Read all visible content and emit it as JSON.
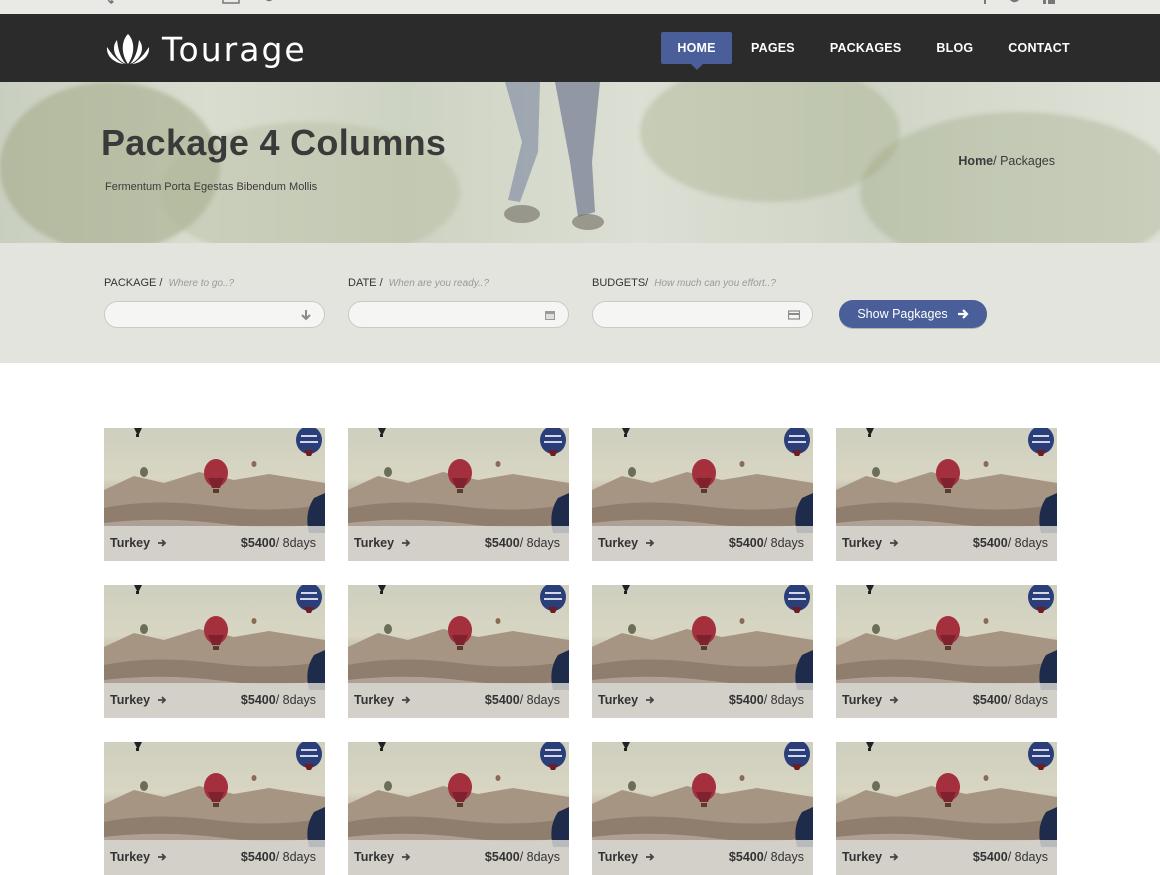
{
  "brand": {
    "name": "Tourage"
  },
  "nav": {
    "items": [
      {
        "label": "HOME",
        "active": true
      },
      {
        "label": "PAGES"
      },
      {
        "label": "PACKAGES"
      },
      {
        "label": "BLOG"
      },
      {
        "label": "CONTACT"
      }
    ]
  },
  "hero": {
    "title": "Package 4 Columns",
    "subtitle": "Fermentum Porta Egestas Bibendum Mollis",
    "breadcrumb": {
      "home": "Home",
      "separator": "/ ",
      "current": "Packages"
    }
  },
  "search": {
    "package": {
      "label": "PACKAGE /",
      "hint": "Where to go..?",
      "value": "",
      "icon": "arrow-down-icon"
    },
    "date": {
      "label": "DATE /",
      "hint": "When are you ready..?",
      "value": "",
      "icon": "calendar-icon"
    },
    "budget": {
      "label": "BUDGETS/",
      "hint": "How much can you effort..?",
      "value": "",
      "icon": "credit-card-icon"
    },
    "button": {
      "label": "Show Pagkages",
      "icon": "arrow-right-icon"
    }
  },
  "packages": [
    {
      "place": "Turkey",
      "price": "$5400",
      "duration": "/ 8days"
    },
    {
      "place": "Turkey",
      "price": "$5400",
      "duration": "/ 8days"
    },
    {
      "place": "Turkey",
      "price": "$5400",
      "duration": "/ 8days"
    },
    {
      "place": "Turkey",
      "price": "$5400",
      "duration": "/ 8days"
    },
    {
      "place": "Turkey",
      "price": "$5400",
      "duration": "/ 8days"
    },
    {
      "place": "Turkey",
      "price": "$5400",
      "duration": "/ 8days"
    },
    {
      "place": "Turkey",
      "price": "$5400",
      "duration": "/ 8days"
    },
    {
      "place": "Turkey",
      "price": "$5400",
      "duration": "/ 8days"
    },
    {
      "place": "Turkey",
      "price": "$5400",
      "duration": "/ 8days"
    },
    {
      "place": "Turkey",
      "price": "$5400",
      "duration": "/ 8days"
    },
    {
      "place": "Turkey",
      "price": "$5400",
      "duration": "/ 8days"
    },
    {
      "place": "Turkey",
      "price": "$5400",
      "duration": "/ 8days"
    }
  ],
  "colors": {
    "accent": "#4a5f99",
    "header": "#2b2b2b",
    "searchBg": "#e3e4de"
  }
}
